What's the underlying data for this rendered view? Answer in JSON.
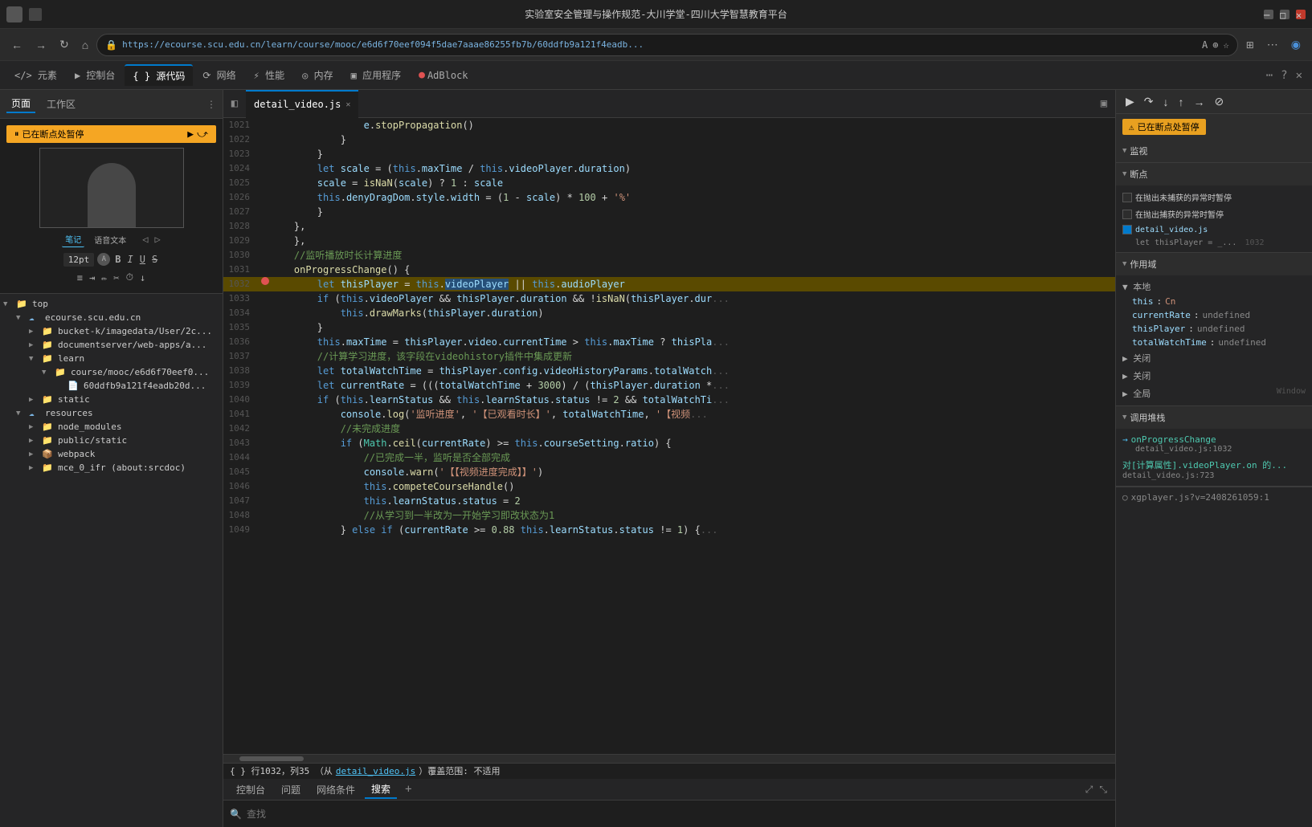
{
  "browser": {
    "title": "实验室安全管理与操作规范-大川学堂-四川大学智慧教育平台",
    "url": "https://ecourse.scu.edu.cn/learn/course/mooc/e6d6f70eef094f5dae7aaae86255fb7b/60ddfb9a121f4eadb...",
    "close_btn": "✕",
    "min_btn": "─",
    "max_btn": "□"
  },
  "nav": {
    "back": "←",
    "forward": "→",
    "refresh": "↻",
    "home": "⌂",
    "lock": "🔒"
  },
  "devtools_tabs": {
    "items": [
      "元素",
      "控制台",
      "源代码",
      "网络",
      "性能",
      "内存",
      "应用程序",
      "AdBlock"
    ],
    "active": "源代码"
  },
  "sidebar": {
    "tabs": [
      "页面",
      "工作区"
    ],
    "active_tab": "页面",
    "tree": [
      {
        "level": 0,
        "label": "top",
        "type": "folder",
        "expanded": true
      },
      {
        "level": 1,
        "label": "ecourse.scu.edu.cn",
        "type": "cloud-folder",
        "expanded": true
      },
      {
        "level": 2,
        "label": "bucket-k/imagedata/User/2c...",
        "type": "folder",
        "expanded": false
      },
      {
        "level": 2,
        "label": "documentserver/web-apps/a...",
        "type": "folder",
        "expanded": false
      },
      {
        "level": 2,
        "label": "learn",
        "type": "folder",
        "expanded": true
      },
      {
        "level": 3,
        "label": "course/mooc/e6d6f70eef0...",
        "type": "folder",
        "expanded": true
      },
      {
        "level": 4,
        "label": "60ddfb9a121f4eadb20d...",
        "type": "file",
        "expanded": false
      },
      {
        "level": 2,
        "label": "static",
        "type": "folder",
        "expanded": false
      },
      {
        "level": 1,
        "label": "resources",
        "type": "cloud-folder",
        "expanded": true
      },
      {
        "level": 2,
        "label": "node_modules",
        "type": "folder",
        "expanded": false
      },
      {
        "level": 2,
        "label": "public/static",
        "type": "folder",
        "expanded": false
      },
      {
        "level": 2,
        "label": "webpack",
        "type": "folder",
        "expanded": false
      },
      {
        "level": 2,
        "label": "mce_0_ifr (about:srcdoc)",
        "type": "file",
        "expanded": false
      }
    ]
  },
  "editor": {
    "file_tab": "detail_video.js",
    "lines": [
      {
        "num": 1021,
        "content": "                e.stopPropagation()"
      },
      {
        "num": 1022,
        "content": "            }"
      },
      {
        "num": 1023,
        "content": "        }"
      },
      {
        "num": 1024,
        "content": "        let scale = (this.maxTime / this.videoPlayer.duration)"
      },
      {
        "num": 1025,
        "content": "        scale = isNaN(scale) ? 1 : scale"
      },
      {
        "num": 1026,
        "content": "        this.denyDragDom.style.width = (1 - scale) * 100 + '%'"
      },
      {
        "num": 1027,
        "content": "        }"
      },
      {
        "num": 1028,
        "content": "    },"
      },
      {
        "num": 1029,
        "content": "    },"
      },
      {
        "num": 1030,
        "content": "    //监听播放时长计算进度"
      },
      {
        "num": 1031,
        "content": "    onProgressChange() {"
      },
      {
        "num": 1032,
        "content": "        let thisPlayer = this.videoPlayer || this.audioPlayer",
        "breakpoint": true,
        "highlighted": true
      },
      {
        "num": 1033,
        "content": "        if (this.videoPlayer && thisPlayer.duration && !isNaN(thisPlayer.dur..."
      },
      {
        "num": 1034,
        "content": "            this.drawMarks(thisPlayer.duration)"
      },
      {
        "num": 1035,
        "content": "        }"
      },
      {
        "num": 1036,
        "content": "        this.maxTime = thisPlayer.video.currentTime > this.maxTime ? thisPla..."
      },
      {
        "num": 1037,
        "content": "        //计算学习进度，该字段在videohistory插件中集成更新"
      },
      {
        "num": 1038,
        "content": "        let totalWatchTime = thisPlayer.config.videoHistoryParams.totalWatch..."
      },
      {
        "num": 1039,
        "content": "        let currentRate = (((totalWatchTime + 3000) / (thisPlayer.duration *..."
      },
      {
        "num": 1040,
        "content": "        if (this.learnStatus && this.learnStatus.status != 2 && totalWatchTi..."
      },
      {
        "num": 1041,
        "content": "            console.log('监听进度', '【已观看时长】', totalWatchTime, '【视频..."
      },
      {
        "num": 1042,
        "content": "            //未完成进度"
      },
      {
        "num": 1043,
        "content": "            if (Math.ceil(currentRate) >= this.courseSetting.ratio) {"
      },
      {
        "num": 1044,
        "content": "                //已完成一半，监听是否全部完成"
      },
      {
        "num": 1045,
        "content": "                console.warn('【【视频进度完成】】')"
      },
      {
        "num": 1046,
        "content": "                this.competeCourseHandle()"
      },
      {
        "num": 1047,
        "content": "                this.learnStatus.status = 2"
      },
      {
        "num": 1048,
        "content": "                //从学习到一半改为一开始学习即改状态为1"
      },
      {
        "num": 1049,
        "content": "            } else if (currentRate >= 0.88 this.learnStatus.status != 1) {..."
      }
    ]
  },
  "debugger": {
    "paused_text": "已在断点处暂停",
    "sections": {
      "watch": "监视",
      "breakpoints": "断点",
      "scope": "作用域",
      "close_sections": [
        "关闭",
        "关闭",
        "全局"
      ],
      "call_stack": "调用堆栈"
    },
    "breakpoint_options": [
      {
        "label": "在抛出未捕获的异常时暂停",
        "checked": false
      },
      {
        "label": "在抛出捕获的异常时暂停",
        "checked": false
      }
    ],
    "current_file": "detail_video.js",
    "current_line": "let thisPlayer = _...",
    "current_line_num": 1032,
    "scope_items": [
      {
        "label": "本地",
        "type": "group"
      },
      {
        "label": "this",
        "value": "Cn"
      },
      {
        "label": "currentRate",
        "value": "undefined"
      },
      {
        "label": "thisPlayer",
        "value": "undefined"
      },
      {
        "label": "totalWatchTime",
        "value": "undefined"
      }
    ],
    "call_stack": [
      {
        "fn": "onProgressChange",
        "file": "detail_video.js:1032"
      },
      {
        "fn": "对[计算属性].videoPlayer.on 的...",
        "file": "detail_video.js:723"
      }
    ],
    "console_dot": "○",
    "xgplayer": "xgplayer.js?v=2408261059:1"
  },
  "status_bar": {
    "text": "{ } 行1032，列35（从detail_video.js）覆盖范围: 不适用"
  },
  "bottom": {
    "tabs": [
      "控制台",
      "问题",
      "网络条件",
      "搜索"
    ],
    "active_tab": "搜索",
    "search_placeholder": "查找"
  },
  "debug_toolbar": {
    "resume": "▶",
    "step_over": "↷",
    "step_into": "↓",
    "step_out": "↑",
    "step": "→",
    "deactivate": "⊘"
  },
  "preview": {
    "note_label": "笔记",
    "voice_label": "语音文本",
    "font_size": "12pt"
  }
}
